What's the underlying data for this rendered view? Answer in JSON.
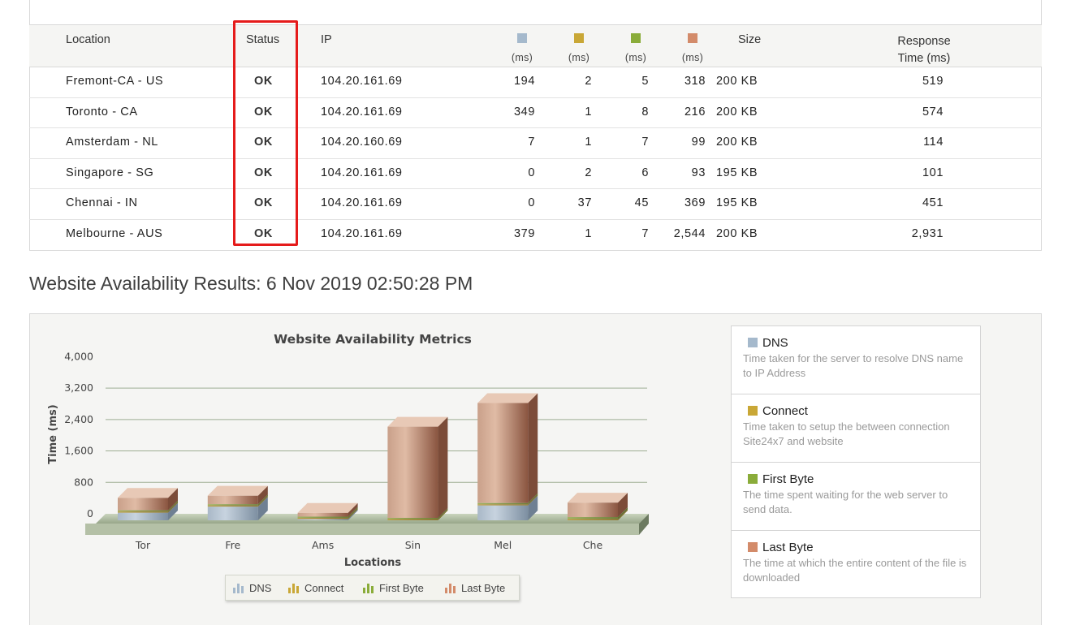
{
  "table": {
    "headers": {
      "location": "Location",
      "status": "Status",
      "ip": "IP",
      "dns_unit": "(ms)",
      "connect_unit": "(ms)",
      "first_byte_unit": "(ms)",
      "last_byte_unit": "(ms)",
      "size": "Size",
      "response_time_line1": "Response",
      "response_time_line2": "Time (ms)"
    },
    "rows": [
      {
        "location": "Fremont-CA - US",
        "status": "OK",
        "ip": "104.20.161.69",
        "dns": "194",
        "connect": "2",
        "first_byte": "5",
        "last_byte": "318",
        "size": "200 KB",
        "response_time": "519"
      },
      {
        "location": "Toronto - CA",
        "status": "OK",
        "ip": "104.20.161.69",
        "dns": "349",
        "connect": "1",
        "first_byte": "8",
        "last_byte": "216",
        "size": "200 KB",
        "response_time": "574"
      },
      {
        "location": "Amsterdam - NL",
        "status": "OK",
        "ip": "104.20.160.69",
        "dns": "7",
        "connect": "1",
        "first_byte": "7",
        "last_byte": "99",
        "size": "200 KB",
        "response_time": "114"
      },
      {
        "location": "Singapore - SG",
        "status": "OK",
        "ip": "104.20.161.69",
        "dns": "0",
        "connect": "2",
        "first_byte": "6",
        "last_byte": "93",
        "size": "195 KB",
        "response_time": "101"
      },
      {
        "location": "Chennai - IN",
        "status": "OK",
        "ip": "104.20.161.69",
        "dns": "0",
        "connect": "37",
        "first_byte": "45",
        "last_byte": "369",
        "size": "195 KB",
        "response_time": "451"
      },
      {
        "location": "Melbourne - AUS",
        "status": "OK",
        "ip": "104.20.161.69",
        "dns": "379",
        "connect": "1",
        "first_byte": "7",
        "last_byte": "2,544",
        "size": "200 KB",
        "response_time": "2,931"
      }
    ]
  },
  "colors": {
    "dns": "#a5b9cc",
    "connect": "#c9a736",
    "first_byte": "#8aac3a",
    "last_byte": "#d38b6a",
    "highlight": "#e51b1b"
  },
  "results_title": "Website Availability Results: 6 Nov 2019 02:50:28 PM",
  "chart_data": {
    "type": "bar",
    "stacked": true,
    "title": "Website Availability Metrics",
    "xlabel": "Locations",
    "ylabel": "Time (ms)",
    "ylim": [
      0,
      4000
    ],
    "yticks": [
      "4,000",
      "3,200",
      "2,400",
      "1,600",
      "800",
      "0"
    ],
    "ytick_values": [
      4000,
      3200,
      2400,
      1600,
      800,
      0
    ],
    "categories": [
      "Tor",
      "Fre",
      "Ams",
      "Sin",
      "Mel",
      "Che"
    ],
    "series": [
      {
        "name": "DNS",
        "values": [
          194,
          349,
          7,
          0,
          379,
          0
        ]
      },
      {
        "name": "Connect",
        "values": [
          2,
          1,
          1,
          2,
          1,
          37
        ]
      },
      {
        "name": "First Byte",
        "values": [
          5,
          8,
          7,
          6,
          7,
          45
        ]
      },
      {
        "name": "Last Byte",
        "values": [
          318,
          216,
          99,
          2323,
          2544,
          369
        ]
      }
    ],
    "grid": true,
    "legend_position": "bottom"
  },
  "legend": {
    "dns": "DNS",
    "connect": "Connect",
    "first_byte": "First Byte",
    "last_byte": "Last Byte"
  },
  "descriptions": [
    {
      "key": "dns",
      "title": "DNS",
      "text": "Time taken for the server to resolve DNS name to IP Address"
    },
    {
      "key": "connect",
      "title": "Connect",
      "text": "Time taken to setup the between connection Site24x7 and website"
    },
    {
      "key": "first_byte",
      "title": "First Byte",
      "text": "The time spent waiting for the web server to send data."
    },
    {
      "key": "last_byte",
      "title": "Last Byte",
      "text": "The time at which the entire content of the file is downloaded"
    }
  ]
}
